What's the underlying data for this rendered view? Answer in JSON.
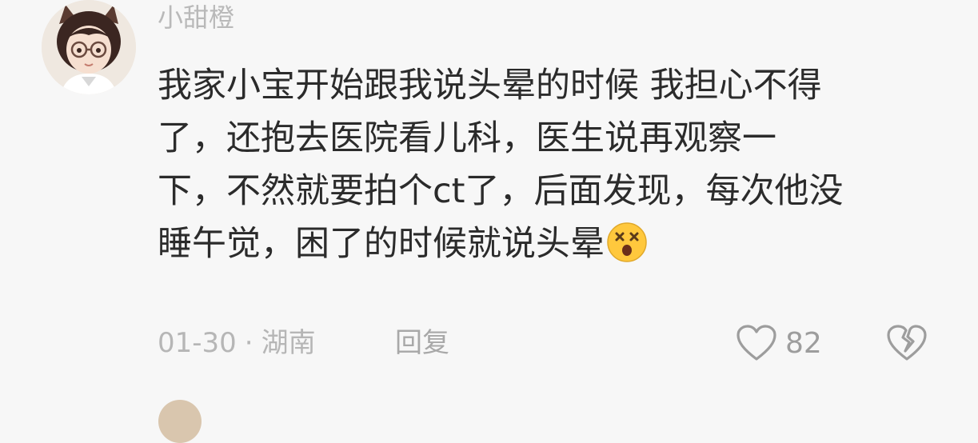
{
  "comment": {
    "username": "小甜橙",
    "content": "我家小宝开始跟我说头晕的时候 我担心不得\n了，还抱去医院看儿科，医生说再观察一\n下，不然就要拍个ct了，后面发现，每次他没\n睡午觉，困了的时候就说头晕",
    "emoji": "dizzy-face-emoji",
    "date": "01-30",
    "separator": "·",
    "location": "湖南",
    "reply_label": "回复",
    "like_count": "82"
  },
  "colors": {
    "background": "#f7f7f7",
    "content_text": "#2b2b2b",
    "meta_text": "#b6b6b6",
    "icon_stroke": "#9d9d9d",
    "emoji_yellow": "#ffc83d"
  }
}
